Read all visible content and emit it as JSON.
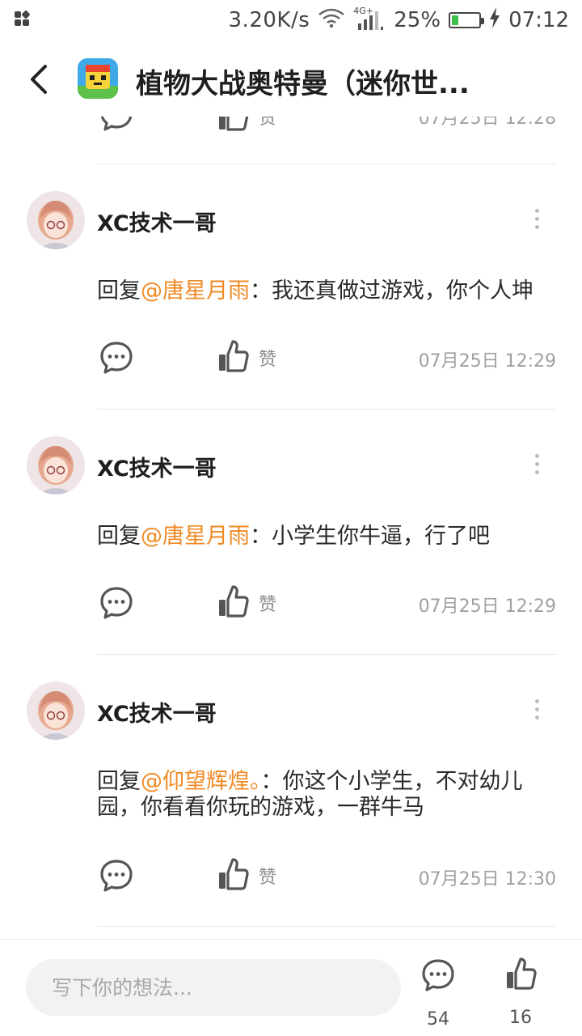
{
  "status_bar": {
    "net_speed": "3.20K/s",
    "network_type": "4G+",
    "battery": "25%",
    "battery_level": 0.25,
    "time": "07:12"
  },
  "header": {
    "title": "植物大战奥特曼（迷你世..."
  },
  "partial_row": {
    "like_label": "赞",
    "timestamp": "07月25日 12:28"
  },
  "comments": [
    {
      "username": "XC技术一哥",
      "reply_prefix": "回复",
      "mention": "@唐星月雨",
      "text": "：我还真做过游戏，你个人坤",
      "like_label": "赞",
      "timestamp": "07月25日 12:29"
    },
    {
      "username": "XC技术一哥",
      "reply_prefix": "回复",
      "mention": "@唐星月雨",
      "text": "：小学生你牛逼，行了吧",
      "like_label": "赞",
      "timestamp": "07月25日 12:29"
    },
    {
      "username": "XC技术一哥",
      "reply_prefix": "回复",
      "mention": "@仰望辉煌。",
      "text": "：你这个小学生，不对幼儿园，你看看你玩的游戏，一群牛马",
      "like_label": "赞",
      "timestamp": "07月25日 12:30"
    }
  ],
  "bottom_bar": {
    "input_placeholder": "写下你的想法...",
    "comment_count": "54",
    "like_count": "16"
  },
  "colors": {
    "mention": "#f08a24",
    "battery_fill": "#3cc14a",
    "muted_text": "#a0a0a0"
  }
}
